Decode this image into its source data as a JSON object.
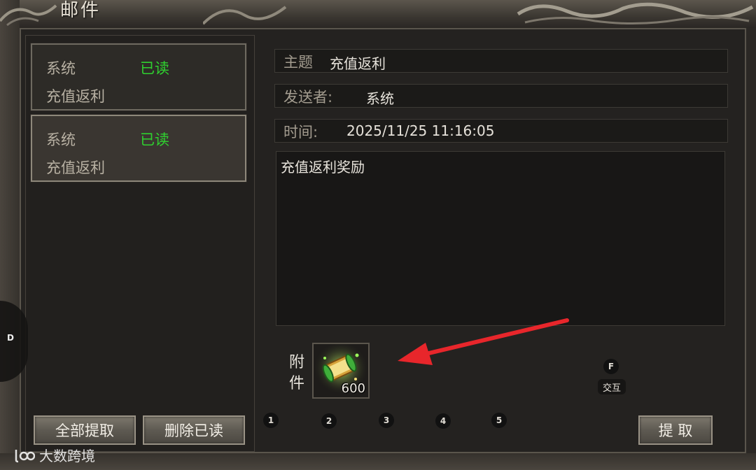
{
  "window": {
    "title": "邮件"
  },
  "mail_list": [
    {
      "sender": "系统",
      "status": "已读",
      "subject": "充值返利"
    },
    {
      "sender": "系统",
      "status": "已读",
      "subject": "充值返利"
    }
  ],
  "detail": {
    "subject_label": "主题",
    "subject_value": "充值返利",
    "sender_label": "发送者:",
    "sender_value": "系统",
    "time_label": "时间:",
    "time_value": "2025/11/25 11:16:05",
    "body": "充值返利奖励",
    "attachment_label": "附件",
    "attachment_count": "600"
  },
  "buttons": {
    "claim_all": "全部提取",
    "delete_read": "删除已读",
    "claim": "提 取"
  },
  "hotkeys": {
    "slots": [
      "1",
      "2",
      "3",
      "4",
      "5"
    ],
    "interact_key": "F",
    "interact_label": "交互",
    "side_key": "D"
  },
  "watermark": "大数跨境",
  "colors": {
    "read_status": "#2fd02f",
    "panel_bg": "#242220",
    "arrow": "#e8262b"
  }
}
